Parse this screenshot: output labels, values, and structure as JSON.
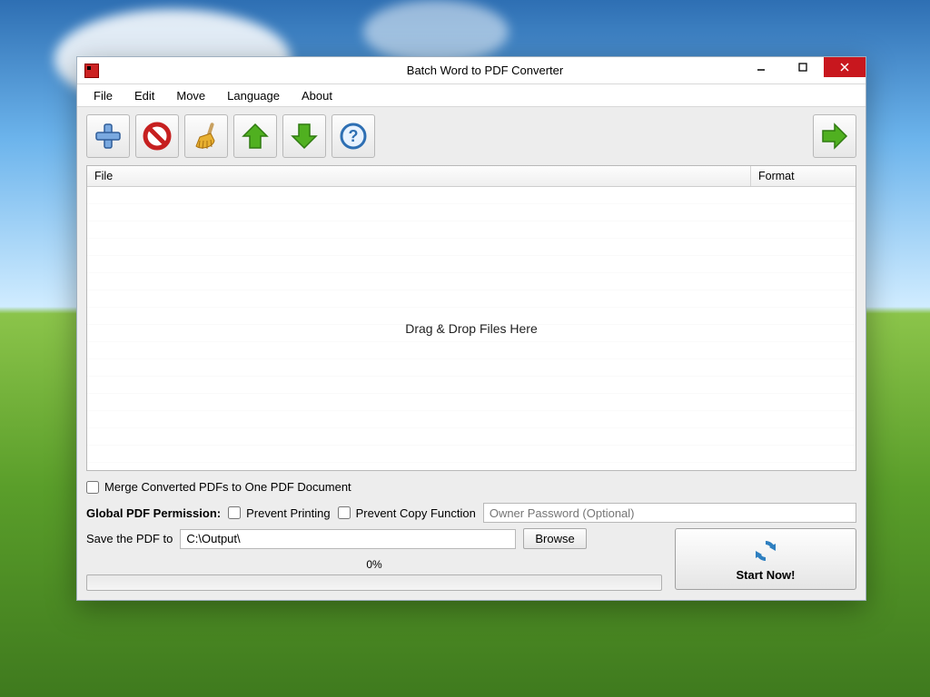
{
  "window": {
    "title": "Batch Word to PDF Converter"
  },
  "menu": {
    "file": "File",
    "edit": "Edit",
    "move": "Move",
    "language": "Language",
    "about": "About"
  },
  "toolbar": {
    "add": "add",
    "remove": "remove",
    "clear": "clear",
    "up": "move-up",
    "down": "move-down",
    "help": "help",
    "convert": "convert"
  },
  "list": {
    "col_file": "File",
    "col_format": "Format",
    "drop_hint": "Drag & Drop Files Here"
  },
  "options": {
    "merge_label": "Merge Converted PDFs to One PDF Document",
    "merge_checked": false,
    "permission_label": "Global PDF Permission:",
    "prevent_print_label": "Prevent Printing",
    "prevent_print_checked": false,
    "prevent_copy_label": "Prevent Copy Function",
    "prevent_copy_checked": false,
    "owner_placeholder": "Owner Password (Optional)",
    "owner_value": ""
  },
  "output": {
    "label": "Save the PDF to",
    "path": "C:\\Output\\",
    "browse": "Browse"
  },
  "progress": {
    "text": "0%"
  },
  "start": {
    "label": "Start Now!"
  }
}
